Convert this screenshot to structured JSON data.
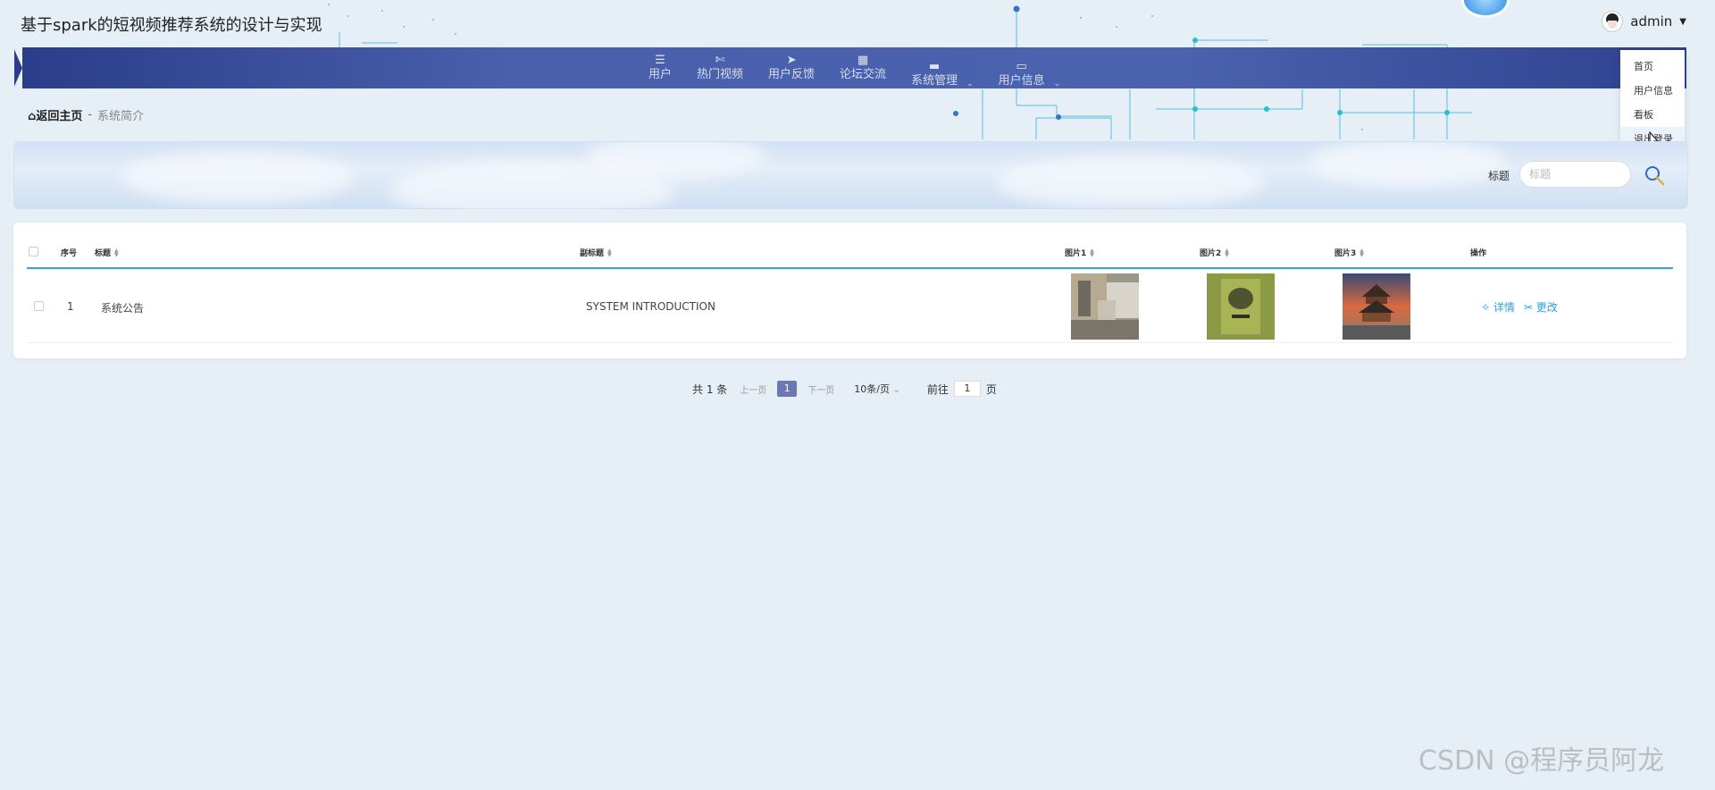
{
  "header": {
    "app_title": "基于spark的短视频推荐系统的设计与实现",
    "username": "admin"
  },
  "nav": {
    "items": [
      {
        "label": "用户",
        "icon": "menu-icon"
      },
      {
        "label": "热门视频",
        "icon": "ticket-icon"
      },
      {
        "label": "用户反馈",
        "icon": "send-icon"
      },
      {
        "label": "论坛交流",
        "icon": "grid-icon"
      },
      {
        "label": "系统管理",
        "icon": "book-icon"
      },
      {
        "label": "用户信息",
        "icon": "card-icon"
      }
    ]
  },
  "user_menu": {
    "items": [
      "首页",
      "用户信息",
      "看板",
      "退出登录"
    ]
  },
  "breadcrumb": {
    "home": "返回主页",
    "separator": "-",
    "current": "系统简介"
  },
  "search": {
    "label": "标题",
    "placeholder": "标题"
  },
  "table": {
    "columns": [
      "序号",
      "标题",
      "副标题",
      "图片1",
      "图片2",
      "图片3",
      "操作"
    ],
    "rows": [
      {
        "index": "1",
        "title": "系统公告",
        "subtitle": "SYSTEM INTRODUCTION",
        "actions": [
          "详情",
          "更改"
        ]
      }
    ]
  },
  "pagination": {
    "total": "共 1 条",
    "prev": "上一页",
    "current_page": "1",
    "next": "下一页",
    "page_size": "10条/页",
    "goto_label": "前往",
    "goto_value": "1",
    "goto_suffix": "页"
  },
  "watermark": "CSDN @程序员阿龙",
  "colors": {
    "nav_bg": "#4b62ae",
    "accent_line": "#3aa2cf",
    "link": "#3a9bd6",
    "page_bg": "#e6eef6"
  }
}
